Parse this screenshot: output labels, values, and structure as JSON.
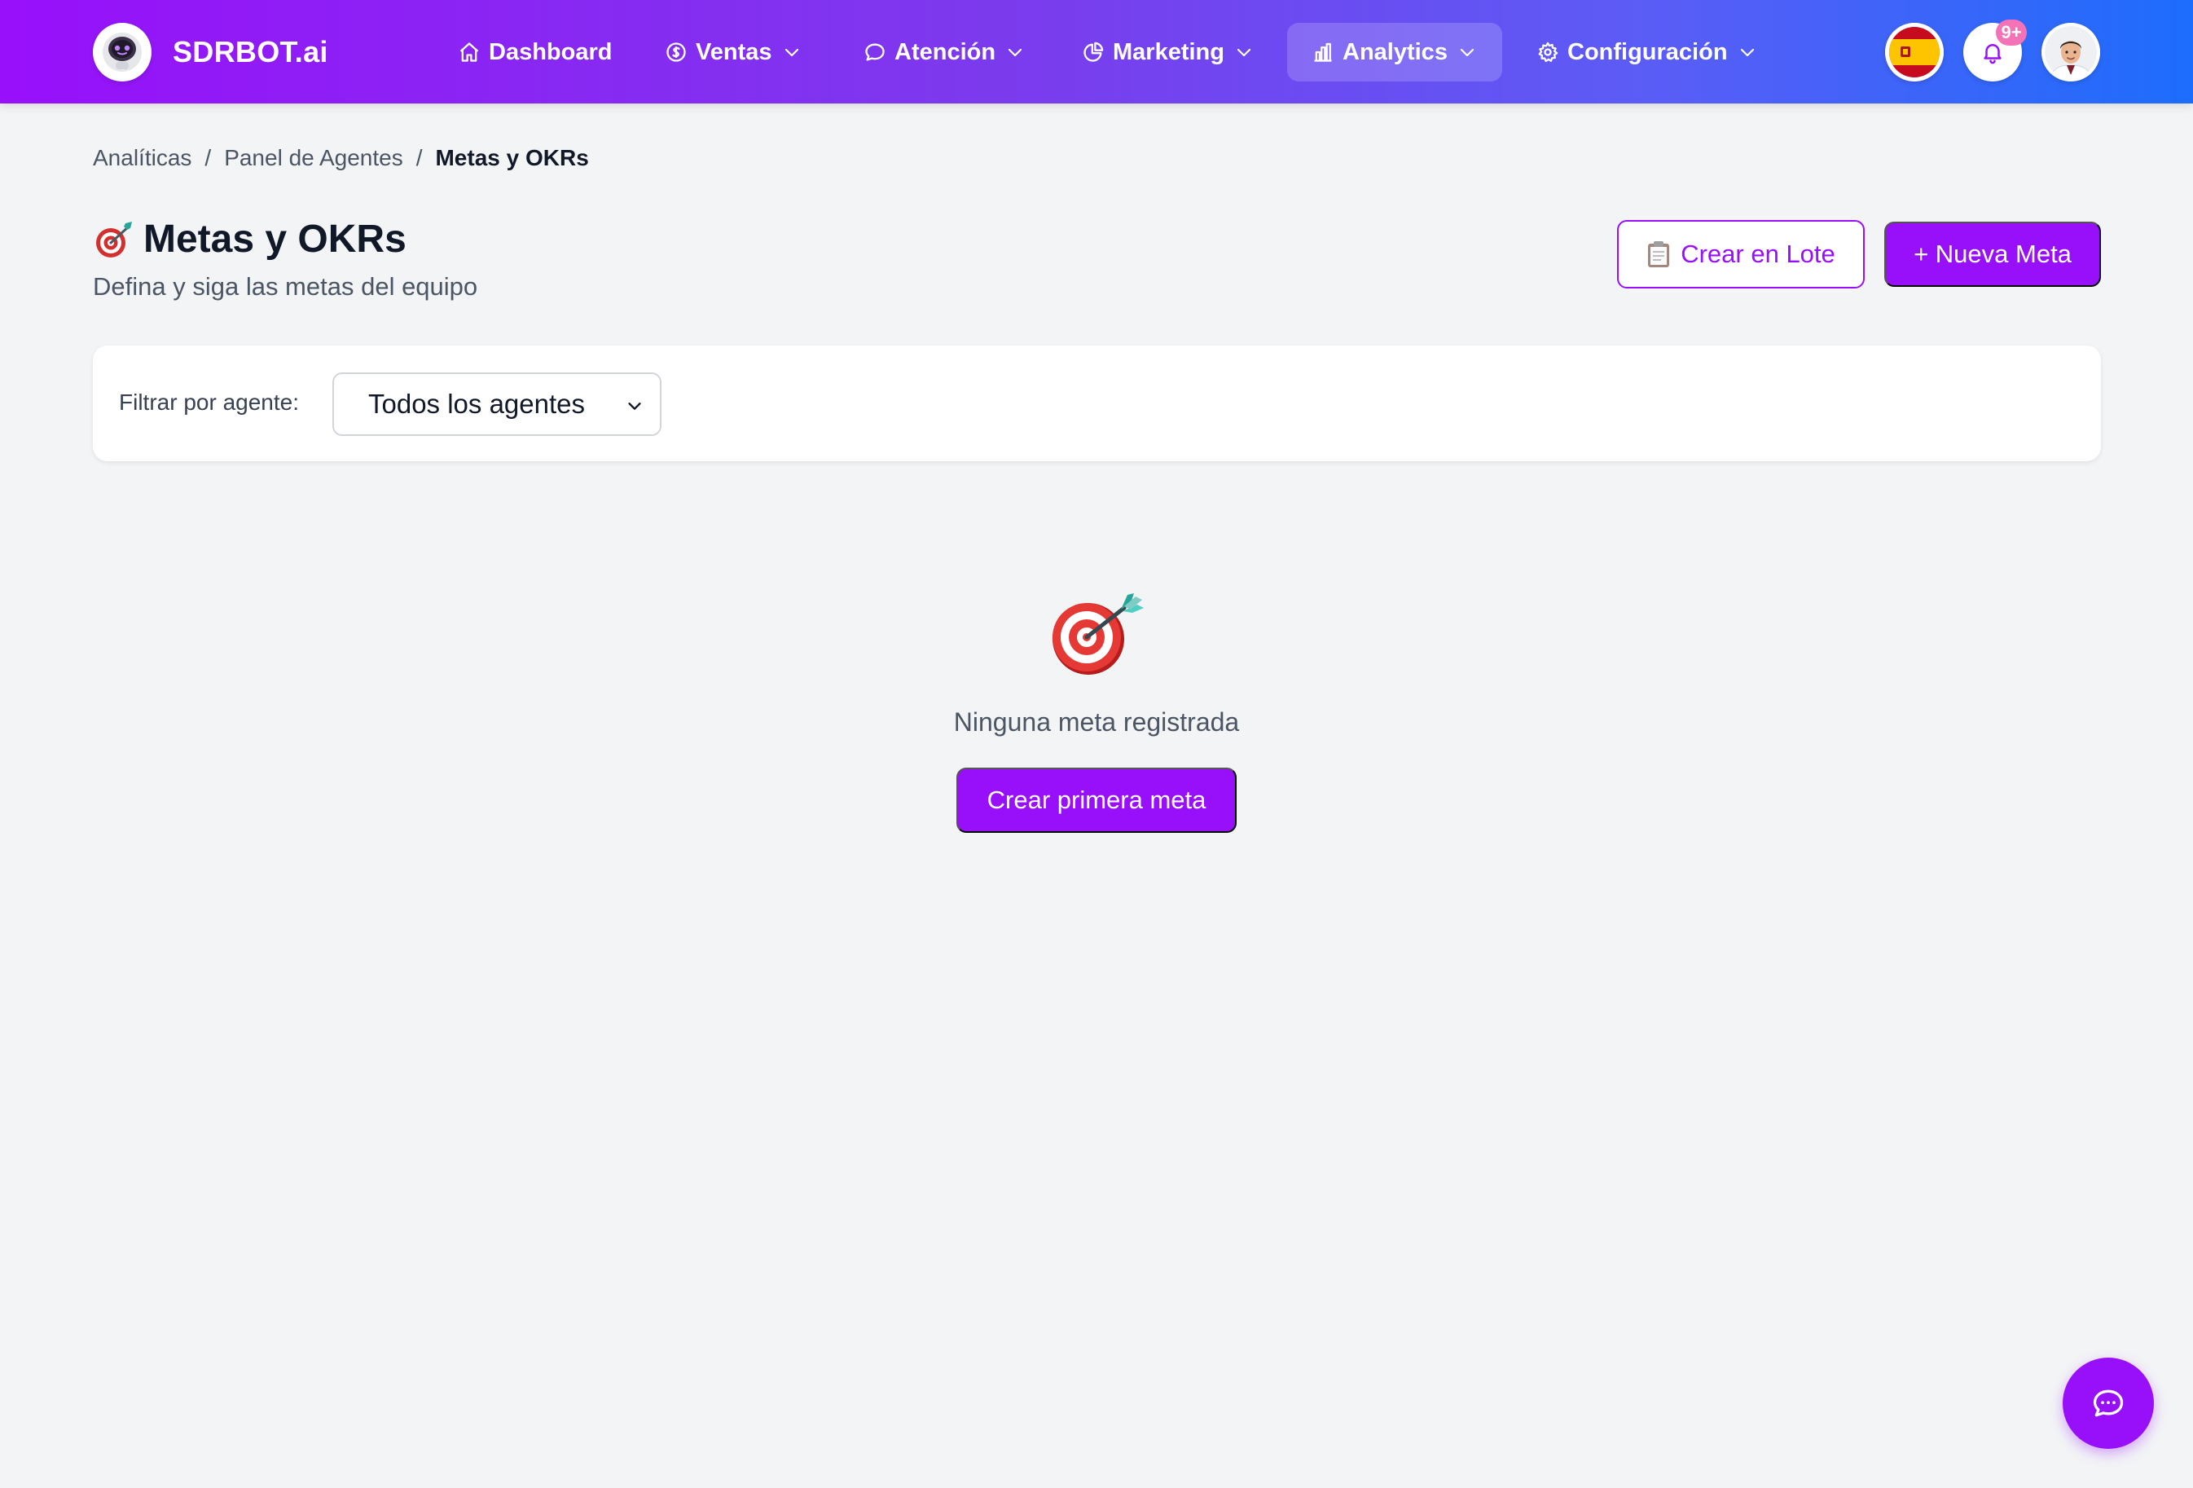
{
  "app": {
    "brand_name": "SDRBOT.ai",
    "accent_color": "#9810fa"
  },
  "nav": {
    "items": [
      {
        "label": "Dashboard",
        "icon": "home-icon",
        "has_dropdown": false,
        "active": false
      },
      {
        "label": "Ventas",
        "icon": "dollar-circle-icon",
        "has_dropdown": true,
        "active": false
      },
      {
        "label": "Atención",
        "icon": "chat-bubble-icon",
        "has_dropdown": true,
        "active": false
      },
      {
        "label": "Marketing",
        "icon": "pie-chart-icon",
        "has_dropdown": true,
        "active": false
      },
      {
        "label": "Analytics",
        "icon": "bar-chart-icon",
        "has_dropdown": true,
        "active": true
      },
      {
        "label": "Configuración",
        "icon": "gear-icon",
        "has_dropdown": true,
        "active": false
      }
    ],
    "notifications_badge": "9+",
    "language_flag": "spain-flag-icon"
  },
  "breadcrumb": {
    "items": [
      "Analíticas",
      "Panel de Agentes",
      "Metas y OKRs"
    ],
    "separator": "/"
  },
  "header": {
    "title": "Metas y OKRs",
    "subtitle": "Defina y siga las metas del equipo",
    "batch_button": "Crear en Lote",
    "new_button": "+ Nueva Meta"
  },
  "filter": {
    "label": "Filtrar por agente:",
    "selected": "Todos los agentes"
  },
  "empty_state": {
    "message": "Ninguna meta registrada",
    "button": "Crear primera meta"
  }
}
